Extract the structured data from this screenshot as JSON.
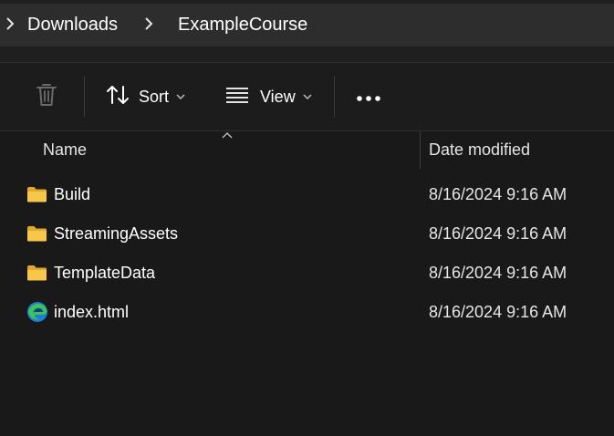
{
  "breadcrumb": {
    "items": [
      "Downloads",
      "ExampleCourse"
    ]
  },
  "toolbar": {
    "delete_icon": "trash-icon",
    "sort_label": "Sort",
    "view_label": "View",
    "more_label": "•••"
  },
  "columns": {
    "name": "Name",
    "date_modified": "Date modified"
  },
  "files": [
    {
      "name": "Build",
      "date": "8/16/2024 9:16 AM",
      "type": "folder"
    },
    {
      "name": "StreamingAssets",
      "date": "8/16/2024 9:16 AM",
      "type": "folder"
    },
    {
      "name": "TemplateData",
      "date": "8/16/2024 9:16 AM",
      "type": "folder"
    },
    {
      "name": "index.html",
      "date": "8/16/2024 9:16 AM",
      "type": "edge-html"
    }
  ],
  "colors": {
    "folder": "#f7c74c",
    "folder_dark": "#e0a92c",
    "edge_blue": "#1b7fd6",
    "edge_green": "#3fc15c"
  }
}
